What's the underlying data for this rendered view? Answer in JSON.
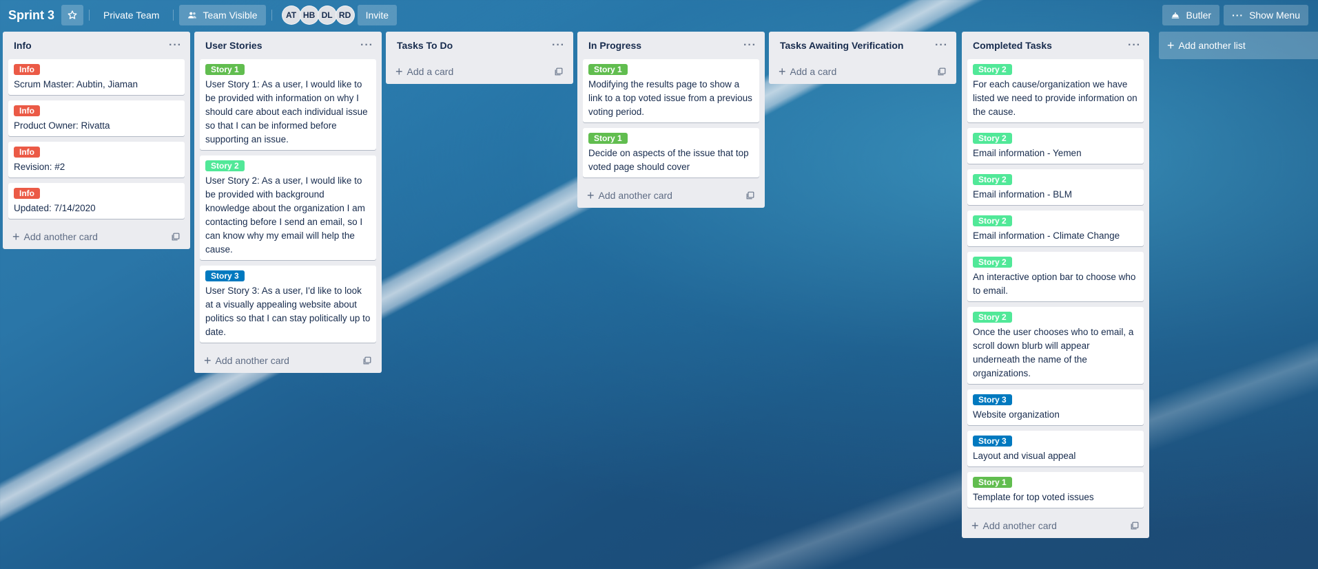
{
  "header": {
    "board_title": "Sprint 3",
    "private_team": "Private Team",
    "visibility": "Team Visible",
    "members": [
      "AT",
      "HB",
      "DL",
      "RD"
    ],
    "invite": "Invite",
    "butler": "Butler",
    "show_menu": "Show Menu"
  },
  "colors": {
    "info": "#eb5a46",
    "story1": "#61bd4f",
    "story2": "#51e898",
    "story3": "#0079bf"
  },
  "lists": [
    {
      "title": "Info",
      "cards": [
        {
          "label": "Info",
          "label_color": "info",
          "text": "Scrum Master: Aubtin, Jiaman"
        },
        {
          "label": "Info",
          "label_color": "info",
          "text": "Product Owner: Rivatta"
        },
        {
          "label": "Info",
          "label_color": "info",
          "text": "Revision: #2"
        },
        {
          "label": "Info",
          "label_color": "info",
          "text": "Updated: 7/14/2020"
        }
      ],
      "add_label": "Add another card"
    },
    {
      "title": "User Stories",
      "cards": [
        {
          "label": "Story 1",
          "label_color": "story1",
          "text": "User Story 1: As a user, I would like to be provided with information on why I should care about each individual issue so that I can be informed before supporting an issue."
        },
        {
          "label": "Story 2",
          "label_color": "story2",
          "text": "User Story 2: As a user, I would like to be provided with background knowledge about the organization I am contacting before I send an email, so I can know why my email will help the cause."
        },
        {
          "label": "Story 3",
          "label_color": "story3",
          "text": "User Story 3: As a user, I'd like to look at a visually appealing website about politics so that I can stay politically up to date."
        }
      ],
      "add_label": "Add another card"
    },
    {
      "title": "Tasks To Do",
      "cards": [],
      "add_label": "Add a card"
    },
    {
      "title": "In Progress",
      "cards": [
        {
          "label": "Story 1",
          "label_color": "story1",
          "text": "Modifying the results page to show a link to a top voted issue from a previous voting period."
        },
        {
          "label": "Story 1",
          "label_color": "story1",
          "text": "Decide on aspects of the issue that top voted page should cover"
        }
      ],
      "add_label": "Add another card"
    },
    {
      "title": "Tasks Awaiting Verification",
      "cards": [],
      "add_label": "Add a card"
    },
    {
      "title": "Completed Tasks",
      "cards": [
        {
          "label": "Story 2",
          "label_color": "story2",
          "text": "For each cause/organization we have listed we need to provide information on the cause."
        },
        {
          "label": "Story 2",
          "label_color": "story2",
          "text": "Email information - Yemen"
        },
        {
          "label": "Story 2",
          "label_color": "story2",
          "text": "Email information - BLM"
        },
        {
          "label": "Story 2",
          "label_color": "story2",
          "text": "Email information - Climate Change"
        },
        {
          "label": "Story 2",
          "label_color": "story2",
          "text": "An interactive option bar to choose who to email."
        },
        {
          "label": "Story 2",
          "label_color": "story2",
          "text": "Once the user chooses who to email, a scroll down blurb will appear underneath the name of the organizations."
        },
        {
          "label": "Story 3",
          "label_color": "story3",
          "text": "Website organization"
        },
        {
          "label": "Story 3",
          "label_color": "story3",
          "text": "Layout and visual appeal"
        },
        {
          "label": "Story 1",
          "label_color": "story1",
          "text": "Template for top voted issues"
        }
      ],
      "add_label": "Add another card"
    }
  ],
  "add_list_label": "Add another list"
}
